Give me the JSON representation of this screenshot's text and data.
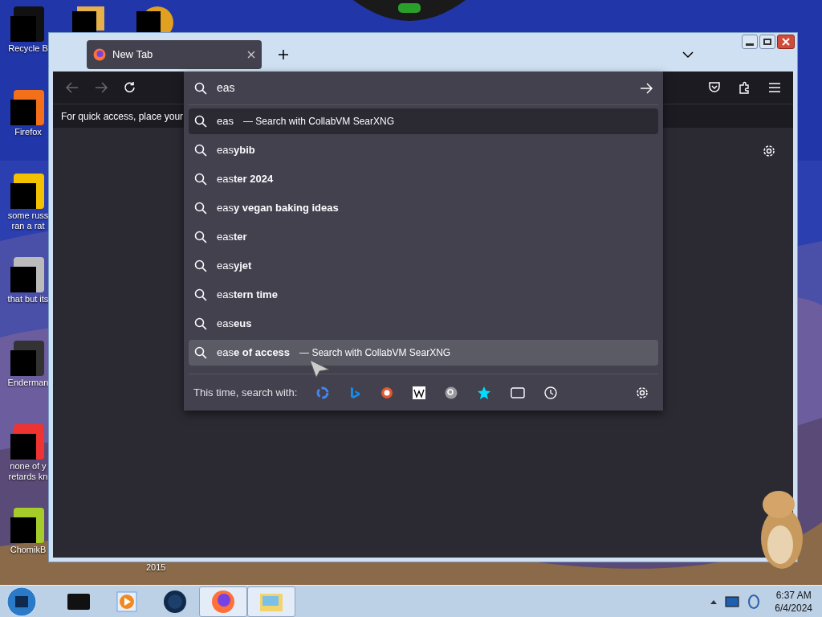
{
  "desktop": {
    "icons": [
      {
        "kind": "bin",
        "lines": [
          "Recycle B"
        ]
      },
      {
        "kind": "fox",
        "lines": [
          "Firefox"
        ]
      },
      {
        "kind": "yellow",
        "lines": [
          "some russ",
          "ran a rat"
        ]
      },
      {
        "kind": "stack",
        "lines": [
          "that but its"
        ]
      },
      {
        "kind": "console",
        "lines": [
          "Enderman"
        ]
      },
      {
        "kind": "red",
        "lines": [
          "none of y",
          "retards kn"
        ]
      },
      {
        "kind": "green",
        "lines": [
          "ChomikB"
        ]
      }
    ],
    "label_below_window": "2015"
  },
  "browser": {
    "tabs": [
      {
        "label": "New Tab",
        "selected": true
      }
    ],
    "bookmarks_hint": "For quick access, place your",
    "urlbar": {
      "value": "eas"
    },
    "suggestions": [
      {
        "kind": "engine",
        "text": "eas",
        "separator": "—",
        "note": "Search with CollabVM SearXNG",
        "selected": true,
        "hovered": false
      },
      {
        "kind": "plain",
        "text": "eas**ybib**",
        "selected": false,
        "hovered": false
      },
      {
        "kind": "plain",
        "text": "eas**ter 2024**",
        "selected": false,
        "hovered": false
      },
      {
        "kind": "plain",
        "text": "eas**y vegan baking ideas**",
        "selected": false,
        "hovered": false
      },
      {
        "kind": "plain",
        "text": "eas**ter**",
        "selected": false,
        "hovered": false
      },
      {
        "kind": "plain",
        "text": "eas**yjet**",
        "selected": false,
        "hovered": false
      },
      {
        "kind": "plain",
        "text": "eas**tern time**",
        "selected": false,
        "hovered": false
      },
      {
        "kind": "plain",
        "text": "eas**eus**",
        "selected": false,
        "hovered": false
      },
      {
        "kind": "engine",
        "text": "eas**e of access**",
        "separator": "—",
        "note": "Search with CollabVM SearXNG",
        "selected": false,
        "hovered": true
      }
    ],
    "search_with_label": "This time, search with:"
  },
  "taskbar": {
    "items": [
      {
        "kind": "console",
        "active": false
      },
      {
        "kind": "player",
        "active": false
      },
      {
        "kind": "globe",
        "active": false
      },
      {
        "kind": "fox",
        "active": true
      },
      {
        "kind": "folder",
        "active": true
      }
    ],
    "clock": {
      "time": "6:37 AM",
      "date": "6/4/2024"
    }
  }
}
